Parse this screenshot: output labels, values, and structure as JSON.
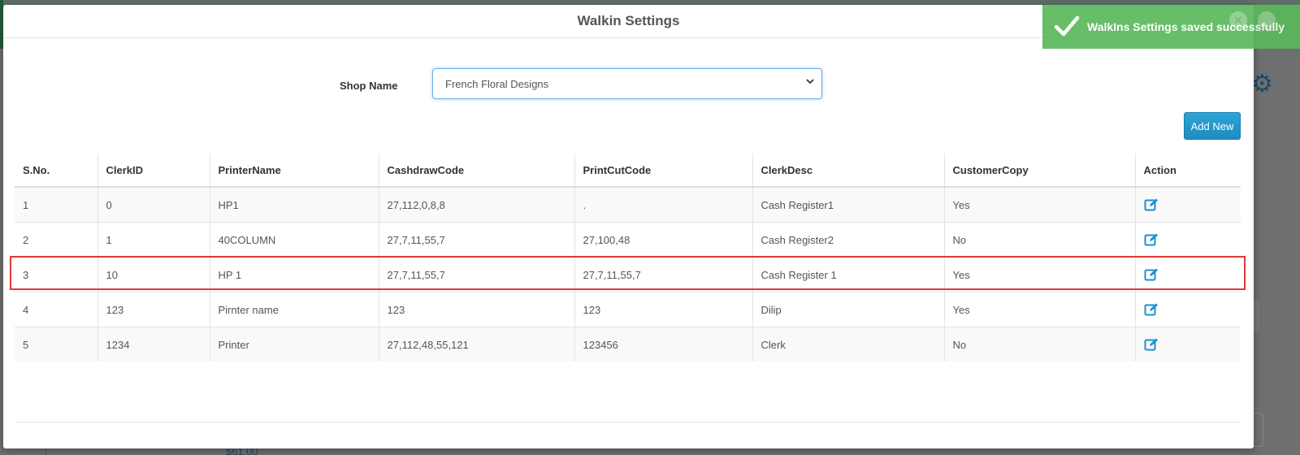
{
  "modal": {
    "title": "Walkin Settings",
    "shop_label": "Shop Name",
    "shop_value": "French Floral Designs",
    "add_button": "Add New"
  },
  "table": {
    "headers": [
      "S.No.",
      "ClerkID",
      "PrinterName",
      "CashdrawCode",
      "PrintCutCode",
      "ClerkDesc",
      "CustomerCopy",
      "Action"
    ],
    "rows": [
      [
        "1",
        "0",
        "HP1",
        "27,112,0,8,8",
        ".",
        "Cash Register1",
        "Yes"
      ],
      [
        "2",
        "1",
        "40COLUMN",
        "27,7,11,55,7",
        "27,100,48",
        "Cash Register2",
        "No"
      ],
      [
        "3",
        "10",
        "HP 1",
        "27,7,11,55,7",
        "27,7,11,55,7",
        "Cash Register 1",
        "Yes"
      ],
      [
        "4",
        "123",
        "Pirnter name",
        "123",
        "123",
        "Dilip",
        "Yes"
      ],
      [
        "5",
        "1234",
        "Printer",
        "27,112,48,55,121",
        "123456",
        "Clerk",
        "No"
      ]
    ],
    "action_icon": "edit-icon"
  },
  "toast": {
    "message": "WalkIns Settings saved successfully",
    "icon": "check-icon"
  },
  "background": {
    "price": "$61.00"
  },
  "colors": {
    "accent": "#1d8cc2",
    "toast": "#5cb85c",
    "highlight": "#e03a3a"
  }
}
